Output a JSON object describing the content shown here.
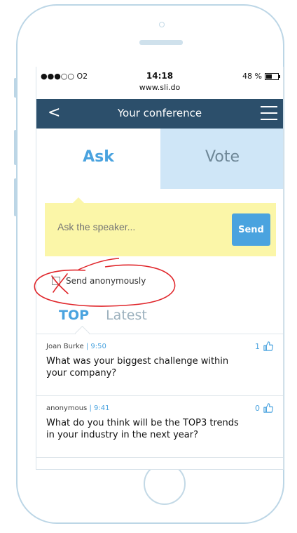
{
  "status_bar": {
    "carrier": "●●●○○ O2 ",
    "time": "14:18",
    "url": "www.sli.do",
    "battery": "48 %"
  },
  "nav": {
    "back_label": "<",
    "title": "Your conference",
    "menu_icon": "hamburger-icon"
  },
  "tabs": [
    {
      "label": "Ask"
    },
    {
      "label": "Vote"
    }
  ],
  "ask": {
    "placeholder": "Ask the speaker...",
    "send_label": "Send"
  },
  "anonymous": {
    "label": "Send anonymously"
  },
  "filters": {
    "top": "TOP",
    "latest": "Latest"
  },
  "questions": [
    {
      "author": "Joan Burke",
      "time": "| 9:50",
      "votes": "1",
      "text": "What was your biggest challenge within your company?"
    },
    {
      "author": "anonymous",
      "time": "| 9:41",
      "votes": "0",
      "text": "What do you think will be the TOP3 trends in your industry in the next year?"
    }
  ],
  "colors": {
    "navbar": "#2c4f6b",
    "accent": "#4aa3df",
    "vote_tab_bg": "#cfe6f7",
    "ask_box_bg": "#fbf6a8",
    "annotation": "#e0262b"
  }
}
